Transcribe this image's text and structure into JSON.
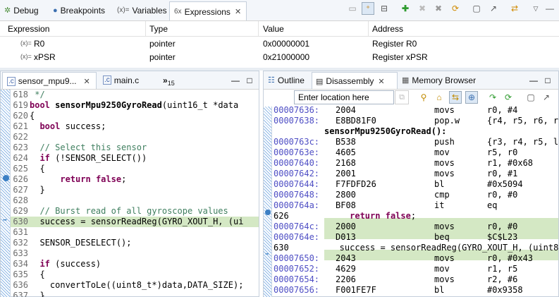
{
  "top_tabs": [
    {
      "icon": "debug-icon",
      "label": "Debug"
    },
    {
      "icon": "breakpoints-icon",
      "label": "Breakpoints"
    },
    {
      "icon": "variables-icon",
      "icon_text": "(x)=",
      "label": "Variables"
    },
    {
      "icon": "expressions-icon",
      "icon_text": "6x",
      "label": "Expressions",
      "close": "✕"
    }
  ],
  "expr_table": {
    "headers": [
      "Expression",
      "Type",
      "Value",
      "Address"
    ],
    "rows": [
      {
        "icon_text": "(x)=",
        "expression": "R0",
        "type": "pointer",
        "value": "0x00000001",
        "address": "Register R0"
      },
      {
        "icon_text": "(x)=",
        "expression": "xPSR",
        "type": "pointer",
        "value": "0x21000000",
        "address": "Register xPSR"
      }
    ]
  },
  "editor": {
    "tabs": [
      {
        "icon_text": ".c",
        "label": "sensor_mpu9...",
        "close": "✕"
      },
      {
        "icon_text": ".c",
        "label": "main.c"
      }
    ],
    "overflow": {
      "glyph": "»",
      "count": "15"
    },
    "minimize": "—",
    "maximize": "□",
    "lines": [
      {
        "n": "618",
        "code": " */"
      },
      {
        "n": "619",
        "code": "bool sensorMpu9250GyroRead(uint16_t *data"
      },
      {
        "n": "620",
        "code": "{"
      },
      {
        "n": "621",
        "code": "  bool success;"
      },
      {
        "n": "622",
        "code": ""
      },
      {
        "n": "623",
        "code": "  // Select this sensor"
      },
      {
        "n": "624",
        "code": "  if (!SENSOR_SELECT())"
      },
      {
        "n": "625",
        "code": "  {"
      },
      {
        "n": "626",
        "code": "      return false;"
      },
      {
        "n": "627",
        "code": "  }"
      },
      {
        "n": "628",
        "code": ""
      },
      {
        "n": "629",
        "code": "  // Burst read of all gyroscope values"
      },
      {
        "n": "630",
        "code": "  success = sensorReadReg(GYRO_XOUT_H, (ui"
      },
      {
        "n": "631",
        "code": ""
      },
      {
        "n": "632",
        "code": "  SENSOR_DESELECT();"
      },
      {
        "n": "633",
        "code": ""
      },
      {
        "n": "634",
        "code": "  if (success)"
      },
      {
        "n": "635",
        "code": "  {"
      },
      {
        "n": "636",
        "code": "    convertToLe((uint8_t*)data,DATA_SIZE);"
      },
      {
        "n": "637",
        "code": "  }"
      }
    ]
  },
  "right": {
    "tabs": [
      {
        "icon": "outline-icon",
        "label": "Outline"
      },
      {
        "icon": "disassembly-icon",
        "label": "Disassembly",
        "close": "✕"
      },
      {
        "icon": "memory-browser-icon",
        "label": "Memory Browser"
      }
    ],
    "minimize": "—",
    "maximize": "□",
    "location_placeholder": "Enter location here",
    "rows": [
      {
        "addr": "00007636:",
        "op": "2004",
        "mn": "movs",
        "args": "r0, #4"
      },
      {
        "addr": "00007638:",
        "op": "E8BD81F0",
        "mn": "pop.w",
        "args": "{r4, r5, r6, r"
      },
      {
        "label": "sensorMpu9250GyroRead():"
      },
      {
        "addr": "0000763c:",
        "op": "B538",
        "mn": "push",
        "args": "{r3, r4, r5, l"
      },
      {
        "addr": "0000763e:",
        "op": "4605",
        "mn": "mov",
        "args": "r5, r0"
      },
      {
        "addr": "00007640:",
        "op": "2168",
        "mn": "movs",
        "args": "r1, #0x68"
      },
      {
        "addr": "00007642:",
        "op": "2001",
        "mn": "movs",
        "args": "r0, #1"
      },
      {
        "addr": "00007644:",
        "op": "F7FDFD26",
        "mn": "bl",
        "args": "#0x5094"
      },
      {
        "addr": "00007648:",
        "op": "2800",
        "mn": "cmp",
        "args": "r0, #0"
      },
      {
        "addr": "0000764a:",
        "op": "BF08",
        "mn": "it",
        "args": "eq"
      },
      {
        "src": "626",
        "text": "     return false;"
      },
      {
        "addr": "0000764c:",
        "op": "2000",
        "mn": "movs",
        "args": "r0, #0"
      },
      {
        "addr": "0000764e:",
        "op": "D013",
        "mn": "beq",
        "args": "$C$L23"
      },
      {
        "src": "630",
        "text": "   success = sensorReadReg(GYRO_XOUT_H, (uint8_t"
      },
      {
        "addr": "00007650:",
        "op": "2043",
        "mn": "movs",
        "args": "r0, #0x43"
      },
      {
        "addr": "00007652:",
        "op": "4629",
        "mn": "mov",
        "args": "r1, r5"
      },
      {
        "addr": "00007654:",
        "op": "2206",
        "mn": "movs",
        "args": "r2, #6"
      },
      {
        "addr": "00007656:",
        "op": "F001FE7F",
        "mn": "bl",
        "args": "#0x9358"
      }
    ]
  },
  "colors": {
    "panel_border": "#c5cfdb",
    "highlight": "#d4e8c4",
    "breakpoint": "#3b7fc4",
    "address": "#4e4ec4",
    "keyword": "#7f0055",
    "comment": "#3f7f5f"
  }
}
